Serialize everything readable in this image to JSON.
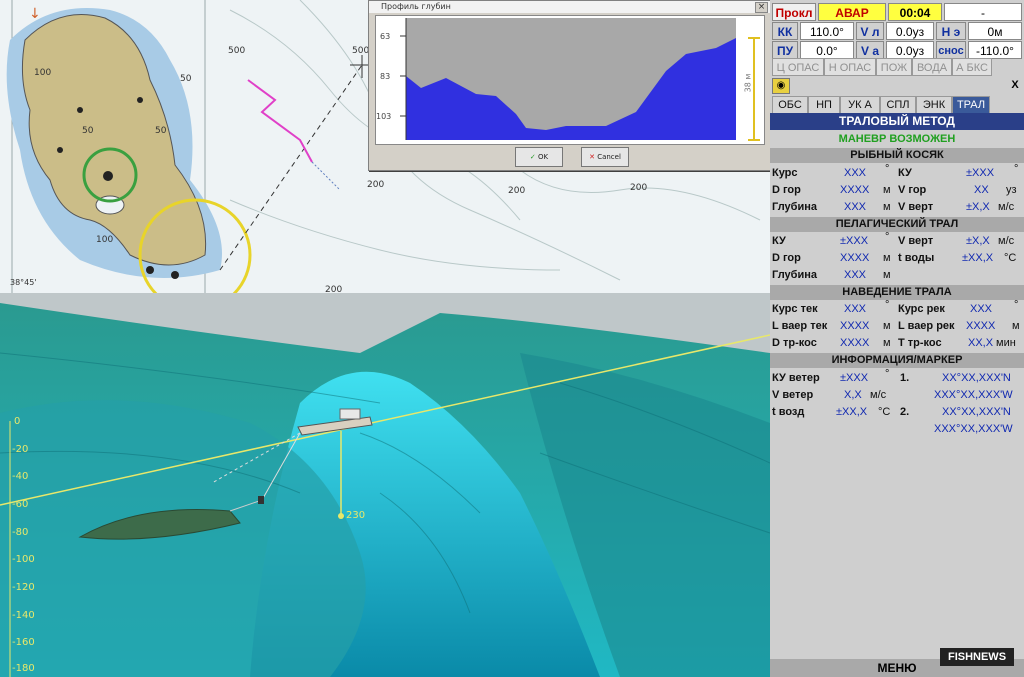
{
  "status": {
    "row1": {
      "mode": "Прокл",
      "alarm": "АВАР",
      "time": "00:04",
      "extra": "-"
    },
    "row2": {
      "kk_label": "КК",
      "kk": "110.0°",
      "vl_label": "V л",
      "vl": "0.0уз",
      "ne_label": "Н э",
      "ne": "0м"
    },
    "row3": {
      "pu_label": "ПУ",
      "pu": "0.0°",
      "va_label": "V а",
      "va": "0.0уз",
      "snos_label": "снос",
      "snos": "-110.0°"
    }
  },
  "alarms": [
    "Ц ОПАС",
    "Н ОПАС",
    "ПОЖ",
    "ВОДА",
    "А БКС"
  ],
  "tabs": [
    "ОБС",
    "НП",
    "УК А",
    "СПЛ",
    "ЭНК",
    "ТРАЛ"
  ],
  "active_tab": "ТРАЛ",
  "method_title": "ТРАЛОВЫЙ МЕТОД",
  "maneuver": "МАНЕВР ВОЗМОЖЕН",
  "fish_school": {
    "title": "РЫБНЫЙ КОСЯК",
    "kurs": "Курс",
    "kurs_v": "XXX",
    "kurs_u": "°",
    "ku": "КУ",
    "ku_v": "±XXX",
    "ku_u": "°",
    "dgor": "D гор",
    "dgor_v": "XXXX",
    "dgor_u": "м",
    "vgor": "V гор",
    "vgor_v": "XX",
    "vgor_u": "уз",
    "glub": "Глубина",
    "glub_v": "XXX",
    "glub_u": "м",
    "vvert": "V верт",
    "vvert_v": "±X,X",
    "vvert_u": "м/с"
  },
  "pelagic": {
    "title": "ПЕЛАГИЧЕСКИЙ ТРАЛ",
    "ku": "КУ",
    "ku_v": "±XXX",
    "ku_u": "°",
    "vvert": "V верт",
    "vvert_v": "±X,X",
    "vvert_u": "м/с",
    "dgor": "D гор",
    "dgor_v": "XXXX",
    "dgor_u": "м",
    "tvody": "t воды",
    "tvody_v": "±XX,X",
    "tvody_u": "°С",
    "glub": "Глубина",
    "glub_v": "XXX",
    "glub_u": "м"
  },
  "guidance": {
    "title": "НАВЕДЕНИЕ ТРАЛА",
    "kurs_tek": "Курс тек",
    "kurs_tek_v": "XXX",
    "kurs_tek_u": "°",
    "kurs_rek": "Курс рек",
    "kurs_rek_v": "XXX",
    "kurs_rek_u": "°",
    "lvaer_tek": "L ваер тек",
    "lvaer_tek_v": "XXXX",
    "lvaer_tek_u": "м",
    "lvaer_rek": "L ваер рек",
    "lvaer_rek_v": "XXXX",
    "lvaer_rek_u": "м",
    "dtrkos": "D тр-кос",
    "dtrkos_v": "XXXX",
    "dtrkos_u": "м",
    "ttrkos": "T тр-кос",
    "ttrkos_v": "XX,X",
    "ttrkos_u": "мин"
  },
  "info": {
    "title": "ИНФОРМАЦИЯ/МАРКЕР",
    "ku_veter": "КУ ветер",
    "ku_veter_v": "±XXX",
    "ku_veter_u": "°",
    "m1": "1.",
    "m1_lat": "XX°XX,XXX'N",
    "m1_lon": "XXX°XX,XXX'W",
    "v_veter": "V ветер",
    "v_veter_v": "X,X",
    "v_veter_u": "м/с",
    "t_vozd": "t возд",
    "t_vozd_v": "±XX,X",
    "t_vozd_u": "°С",
    "m2": "2.",
    "m2_lat": "XX°XX,XXX'N",
    "m2_lon": "XXX°XX,XXX'W"
  },
  "menu": "МЕНЮ",
  "close_x": "X",
  "dialog": {
    "title": "Профиль глубин",
    "ok": "OK",
    "cancel": "Cancel",
    "depth_ticks": [
      "63",
      "83",
      "103"
    ],
    "span": "38 м"
  },
  "chart_labels": {
    "depths": [
      "500",
      "500",
      "200",
      "200",
      "200",
      "200",
      "100",
      "50",
      "50",
      "50",
      "100"
    ],
    "lat": "38°45'"
  },
  "scene": {
    "depth_scale": [
      "0",
      "-20",
      "-40",
      "-60",
      "-80",
      "-100",
      "-120",
      "-140",
      "-160",
      "-180"
    ],
    "marker": "230"
  },
  "brand": "FISHNEWS",
  "colors": {
    "land": "#c9b982",
    "shallow": "#9cc4e4",
    "sea": "#e8f0f4",
    "terrain": "#1fb6c0",
    "panel_blue": "#2a3f88"
  }
}
